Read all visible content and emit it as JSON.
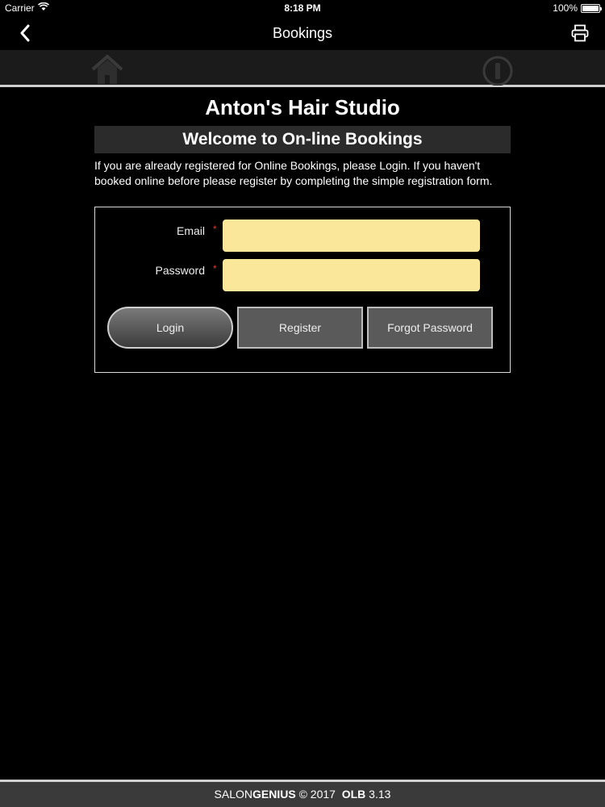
{
  "status_bar": {
    "carrier": "Carrier",
    "time": "8:18 PM",
    "battery": "100%"
  },
  "nav": {
    "title": "Bookings",
    "back_icon": "chevron-left-icon",
    "print_icon": "printer-icon"
  },
  "toolbar": {
    "home_icon": "home-icon",
    "info_icon": "info-icon"
  },
  "main": {
    "studio_name": "Anton's Hair Studio",
    "welcome": "Welcome to On-line Bookings",
    "intro": "If you are already registered for Online Bookings, please Login. If you haven't booked online before please register by completing the simple registration form."
  },
  "login_form": {
    "email_label": "Email",
    "email_value": "",
    "password_label": "Password",
    "password_value": "",
    "required_marker": "*",
    "login_button": "Login",
    "register_button": "Register",
    "forgot_button": "Forgot Password"
  },
  "footer": {
    "brand_light": "SALON",
    "brand_bold": "GENIUS",
    "copyright": " © 2017 ",
    "product": "OLB",
    "version": " 3.13"
  },
  "colors": {
    "input_bg": "#fbe79a",
    "required": "#e03c2c",
    "background": "#000000"
  }
}
